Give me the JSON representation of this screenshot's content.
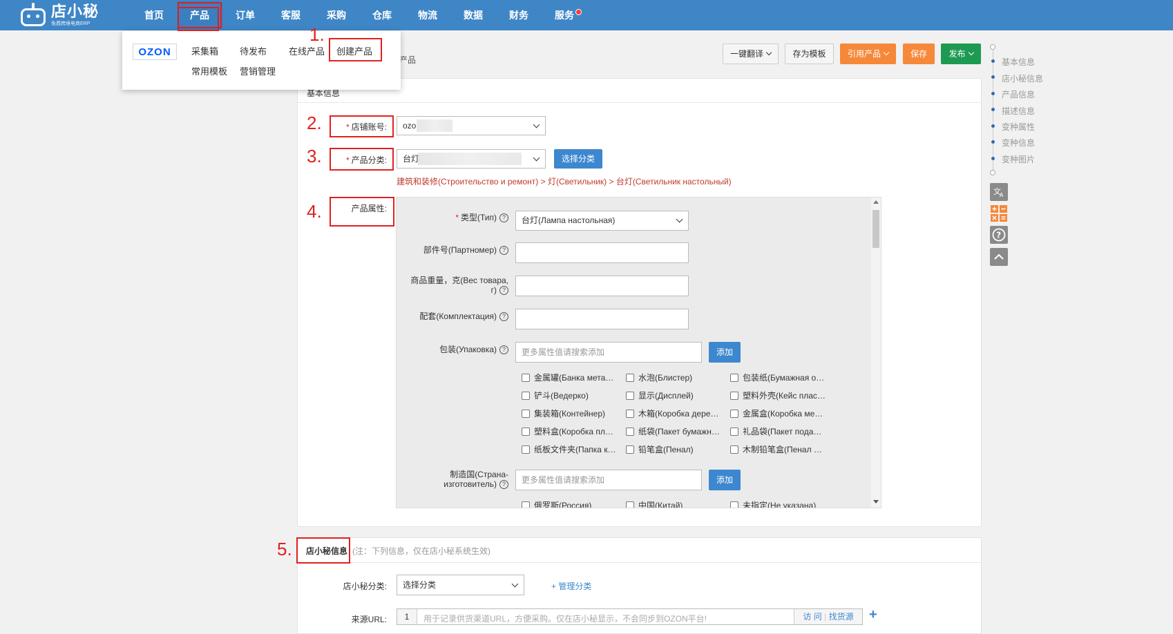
{
  "brand": {
    "name": "店小秘",
    "subtitle": "免费跨境电商ERP"
  },
  "nav": [
    "首页",
    "产品",
    "订单",
    "客服",
    "采购",
    "仓库",
    "物流",
    "数据",
    "财务",
    "服务"
  ],
  "dropdown": {
    "logo": "OZON",
    "items": [
      "采集箱",
      "待发布",
      "在线产品",
      "创建产品",
      "常用模板",
      "营销管理"
    ]
  },
  "annotations": [
    "1.",
    "2.",
    "3.",
    "4.",
    "5."
  ],
  "breadcrumb_fragment": "产品",
  "toolbar": {
    "translate": "一键翻译",
    "save_template": "存为模板",
    "quote_product": "引用产品",
    "save": "保存",
    "publish": "发布"
  },
  "basic": {
    "header": "基本信息",
    "shop_label": "店铺账号:",
    "shop_value": "ozo",
    "category_label": "产品分类:",
    "category_value": "台灯",
    "choose_category": "选择分类",
    "category_path": "建筑和装修(Строительство и ремонт) > 灯(Светильник) > 台灯(Светильник настольный)",
    "attr_label": "产品属性:"
  },
  "attrs": {
    "type_label": "类型(Тип)",
    "type_value": "台灯(Лампа настольная)",
    "part_label": "部件号(Партномер)",
    "weight_label_1": "商品重量，克(Вес товара,",
    "weight_label_2": "г)",
    "kit_label": "配套(Комплектация)",
    "pack_label": "包装(Упаковка)",
    "search_placeholder": "更多属性值请搜索添加",
    "add": "添加",
    "pack_options": [
      "金属罐(Банка мета…",
      "水泡(Блистер)",
      "包装纸(Бумажная о…",
      "铲斗(Ведерко)",
      "显示(Дисплей)",
      "塑料外壳(Кейс плас…",
      "集装箱(Контейнер)",
      "木箱(Коробка дере…",
      "金属盒(Коробка ме…",
      "塑料盒(Коробка пл…",
      "纸袋(Пакет бумажн…",
      "礼品袋(Пакет пода…",
      "纸板文件夹(Папка к…",
      "铅笔盒(Пенал)",
      "木制铅笔盒(Пенал …"
    ],
    "country_label_1": "制造国(Страна-",
    "country_label_2": "изготовитель)",
    "country_options": [
      "俄罗斯(Россия)",
      "中国(Китай)",
      "未指定(Не указана)"
    ]
  },
  "dxm": {
    "header": "店小秘信息",
    "note": "(注：下列信息，仅在店小秘系统生效)",
    "cat_label": "店小秘分类:",
    "cat_placeholder": "选择分类",
    "manage": "+ 管理分类",
    "url_label": "来源URL:",
    "url_index": "1",
    "url_placeholder": "用于记录供货渠道URL，方便采购。仅在店小秘显示，不会同步到OZON平台!",
    "visit": "访 问",
    "find_source": "找货源",
    "plus": "+"
  },
  "toc": [
    "基本信息",
    "店小秘信息",
    "产品信息",
    "描述信息",
    "变种属性",
    "变种信息",
    "变种图片"
  ],
  "colors": {
    "topbar": "#3f86c7",
    "annotation": "#e02020",
    "orange": "#f6883a",
    "green": "#1d9a52"
  }
}
